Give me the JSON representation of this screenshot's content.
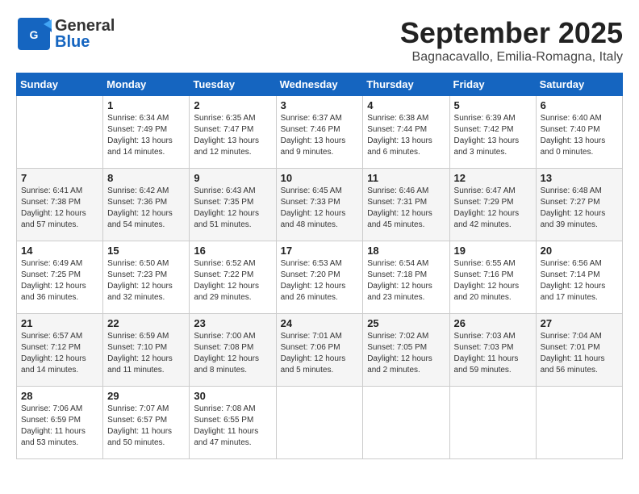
{
  "header": {
    "logo_line1": "General",
    "logo_line2": "Blue",
    "month": "September 2025",
    "location": "Bagnacavallo, Emilia-Romagna, Italy"
  },
  "days_of_week": [
    "Sunday",
    "Monday",
    "Tuesday",
    "Wednesday",
    "Thursday",
    "Friday",
    "Saturday"
  ],
  "weeks": [
    [
      {
        "day": "",
        "info": ""
      },
      {
        "day": "1",
        "info": "Sunrise: 6:34 AM\nSunset: 7:49 PM\nDaylight: 13 hours\nand 14 minutes."
      },
      {
        "day": "2",
        "info": "Sunrise: 6:35 AM\nSunset: 7:47 PM\nDaylight: 13 hours\nand 12 minutes."
      },
      {
        "day": "3",
        "info": "Sunrise: 6:37 AM\nSunset: 7:46 PM\nDaylight: 13 hours\nand 9 minutes."
      },
      {
        "day": "4",
        "info": "Sunrise: 6:38 AM\nSunset: 7:44 PM\nDaylight: 13 hours\nand 6 minutes."
      },
      {
        "day": "5",
        "info": "Sunrise: 6:39 AM\nSunset: 7:42 PM\nDaylight: 13 hours\nand 3 minutes."
      },
      {
        "day": "6",
        "info": "Sunrise: 6:40 AM\nSunset: 7:40 PM\nDaylight: 13 hours\nand 0 minutes."
      }
    ],
    [
      {
        "day": "7",
        "info": "Sunrise: 6:41 AM\nSunset: 7:38 PM\nDaylight: 12 hours\nand 57 minutes."
      },
      {
        "day": "8",
        "info": "Sunrise: 6:42 AM\nSunset: 7:36 PM\nDaylight: 12 hours\nand 54 minutes."
      },
      {
        "day": "9",
        "info": "Sunrise: 6:43 AM\nSunset: 7:35 PM\nDaylight: 12 hours\nand 51 minutes."
      },
      {
        "day": "10",
        "info": "Sunrise: 6:45 AM\nSunset: 7:33 PM\nDaylight: 12 hours\nand 48 minutes."
      },
      {
        "day": "11",
        "info": "Sunrise: 6:46 AM\nSunset: 7:31 PM\nDaylight: 12 hours\nand 45 minutes."
      },
      {
        "day": "12",
        "info": "Sunrise: 6:47 AM\nSunset: 7:29 PM\nDaylight: 12 hours\nand 42 minutes."
      },
      {
        "day": "13",
        "info": "Sunrise: 6:48 AM\nSunset: 7:27 PM\nDaylight: 12 hours\nand 39 minutes."
      }
    ],
    [
      {
        "day": "14",
        "info": "Sunrise: 6:49 AM\nSunset: 7:25 PM\nDaylight: 12 hours\nand 36 minutes."
      },
      {
        "day": "15",
        "info": "Sunrise: 6:50 AM\nSunset: 7:23 PM\nDaylight: 12 hours\nand 32 minutes."
      },
      {
        "day": "16",
        "info": "Sunrise: 6:52 AM\nSunset: 7:22 PM\nDaylight: 12 hours\nand 29 minutes."
      },
      {
        "day": "17",
        "info": "Sunrise: 6:53 AM\nSunset: 7:20 PM\nDaylight: 12 hours\nand 26 minutes."
      },
      {
        "day": "18",
        "info": "Sunrise: 6:54 AM\nSunset: 7:18 PM\nDaylight: 12 hours\nand 23 minutes."
      },
      {
        "day": "19",
        "info": "Sunrise: 6:55 AM\nSunset: 7:16 PM\nDaylight: 12 hours\nand 20 minutes."
      },
      {
        "day": "20",
        "info": "Sunrise: 6:56 AM\nSunset: 7:14 PM\nDaylight: 12 hours\nand 17 minutes."
      }
    ],
    [
      {
        "day": "21",
        "info": "Sunrise: 6:57 AM\nSunset: 7:12 PM\nDaylight: 12 hours\nand 14 minutes."
      },
      {
        "day": "22",
        "info": "Sunrise: 6:59 AM\nSunset: 7:10 PM\nDaylight: 12 hours\nand 11 minutes."
      },
      {
        "day": "23",
        "info": "Sunrise: 7:00 AM\nSunset: 7:08 PM\nDaylight: 12 hours\nand 8 minutes."
      },
      {
        "day": "24",
        "info": "Sunrise: 7:01 AM\nSunset: 7:06 PM\nDaylight: 12 hours\nand 5 minutes."
      },
      {
        "day": "25",
        "info": "Sunrise: 7:02 AM\nSunset: 7:05 PM\nDaylight: 12 hours\nand 2 minutes."
      },
      {
        "day": "26",
        "info": "Sunrise: 7:03 AM\nSunset: 7:03 PM\nDaylight: 11 hours\nand 59 minutes."
      },
      {
        "day": "27",
        "info": "Sunrise: 7:04 AM\nSunset: 7:01 PM\nDaylight: 11 hours\nand 56 minutes."
      }
    ],
    [
      {
        "day": "28",
        "info": "Sunrise: 7:06 AM\nSunset: 6:59 PM\nDaylight: 11 hours\nand 53 minutes."
      },
      {
        "day": "29",
        "info": "Sunrise: 7:07 AM\nSunset: 6:57 PM\nDaylight: 11 hours\nand 50 minutes."
      },
      {
        "day": "30",
        "info": "Sunrise: 7:08 AM\nSunset: 6:55 PM\nDaylight: 11 hours\nand 47 minutes."
      },
      {
        "day": "",
        "info": ""
      },
      {
        "day": "",
        "info": ""
      },
      {
        "day": "",
        "info": ""
      },
      {
        "day": "",
        "info": ""
      }
    ]
  ]
}
